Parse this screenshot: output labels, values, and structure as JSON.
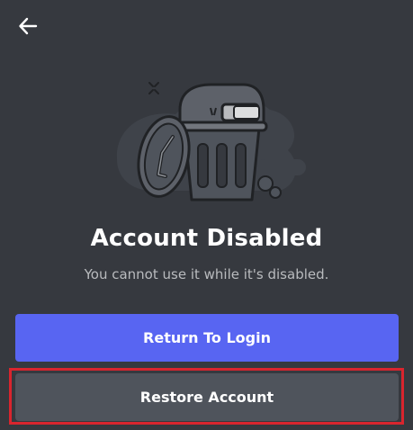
{
  "header": {
    "back_icon": "arrow-left-icon"
  },
  "illustration": {
    "name": "trash-can-illustration"
  },
  "main": {
    "title": "Account Disabled",
    "subtitle": "You cannot use it while it's disabled."
  },
  "actions": {
    "return_label": "Return To Login",
    "restore_label": "Restore Account"
  },
  "colors": {
    "background": "#36393f",
    "primary": "#5865f2",
    "secondary": "#4f545c",
    "highlight": "#d9252e"
  }
}
